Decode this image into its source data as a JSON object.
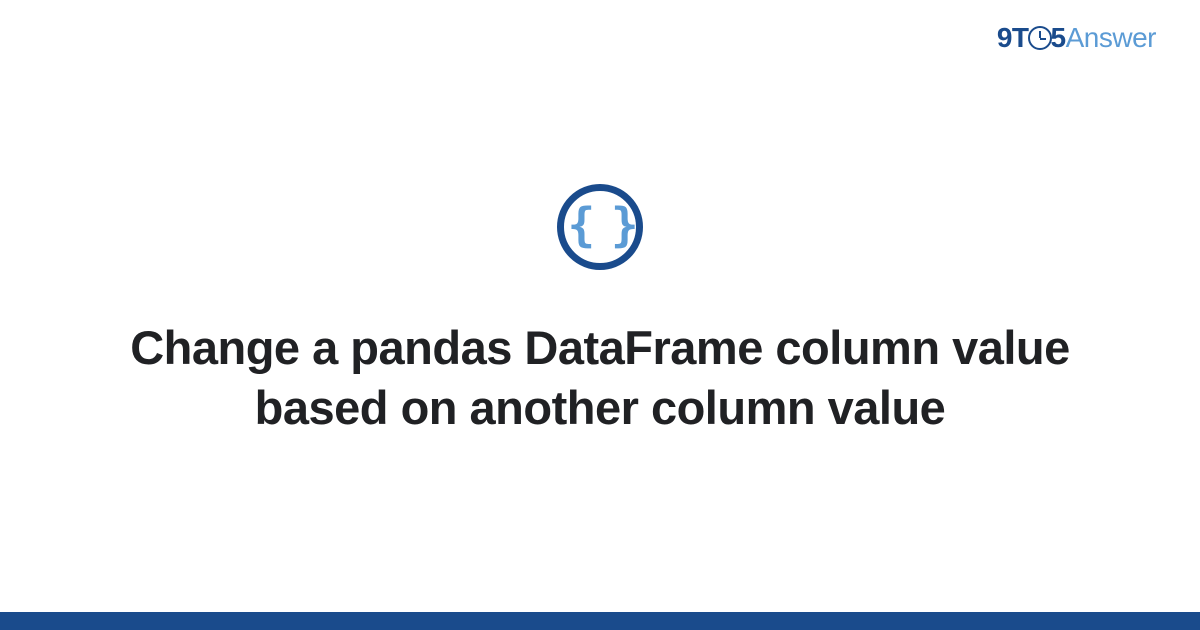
{
  "brand": {
    "part1": "9T",
    "part2": "5",
    "part3": "Answer"
  },
  "badge": {
    "glyph": "{ }"
  },
  "title": "Change a pandas DataFrame column value based on another column value"
}
